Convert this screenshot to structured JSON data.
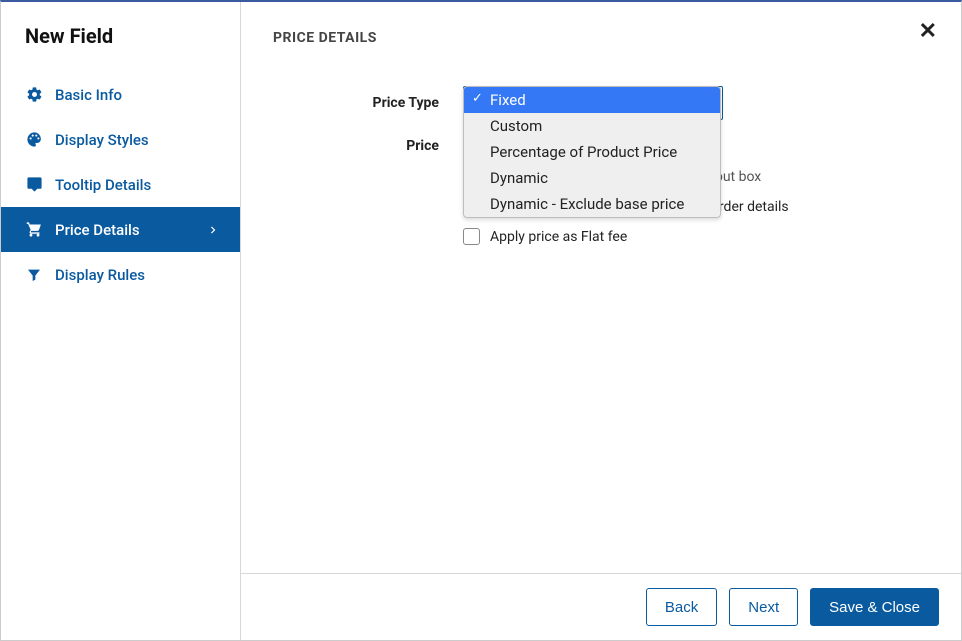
{
  "header": {
    "title": "New Field"
  },
  "sidebar": {
    "items": [
      {
        "label": "Basic Info",
        "icon": "gear-icon"
      },
      {
        "label": "Display Styles",
        "icon": "palette-icon"
      },
      {
        "label": "Tooltip Details",
        "icon": "tooltip-icon"
      },
      {
        "label": "Price Details",
        "icon": "cart-icon",
        "active": true
      },
      {
        "label": "Display Rules",
        "icon": "filter-icon"
      }
    ]
  },
  "main": {
    "section_title": "PRICE DETAILS",
    "labels": {
      "price_type": "Price Type",
      "price": "Price"
    },
    "price_type": {
      "selected": "Fixed",
      "options": [
        "Fixed",
        "Custom",
        "Percentage of Product Price",
        "Dynamic",
        "Dynamic - Exclude base price"
      ]
    },
    "checkboxes": {
      "display_label": {
        "label": "Display price label along with field input box",
        "checked": true
      },
      "display_in_cart": {
        "label": "Display price in Cart, Checkout and Order details",
        "checked": true
      },
      "flat_fee": {
        "label": "Apply price as Flat fee",
        "checked": false
      }
    }
  },
  "footer": {
    "back": "Back",
    "next": "Next",
    "save": "Save & Close"
  }
}
